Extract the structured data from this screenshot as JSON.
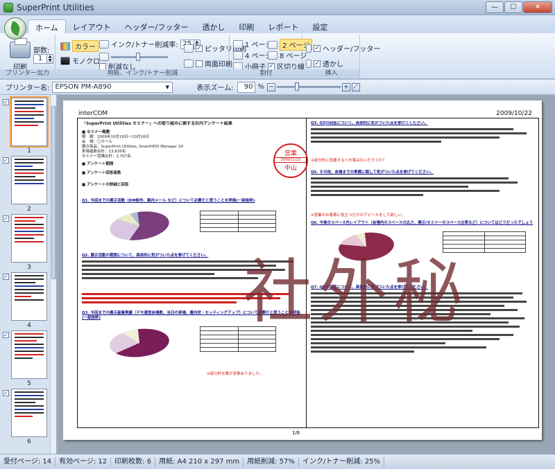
{
  "window": {
    "title": "SuperPrint Utilities"
  },
  "ribbon": {
    "tabs": [
      "ホーム",
      "レイアウト",
      "ヘッダー/フッター",
      "透かし",
      "印刷",
      "レポート",
      "設定"
    ],
    "print_output": {
      "label": "プリンター出力",
      "print_button": "印刷",
      "copies_label": "部数:",
      "copies_value": "1"
    },
    "paper_ink": {
      "label": "用紙、インク/トナー削減",
      "color_button": "カラー",
      "mono_button": "モノクロ",
      "ink_reduction_label": "インク/トナー削減率:",
      "ink_reduction_value": "25",
      "no_reduction_label": "削減なし",
      "fit_print_label": "ピッタリ印刷",
      "duplex_label": "両面印刷"
    },
    "imposition": {
      "label": "割付",
      "one_page": "1 ページ",
      "two_page": "2 ページ",
      "four_page": "4 ページ",
      "eight_page": "8 ページ",
      "booklet": "小冊子",
      "divider_line": "区切り線"
    },
    "insert": {
      "label": "挿入",
      "header_footer": "ヘッダー/フッター",
      "watermark": "透かし"
    }
  },
  "toolbar": {
    "printer_label": "プリンター名:",
    "printer_value": "EPSON PM-A890",
    "zoom_label": "表示ズーム:",
    "zoom_value": "90",
    "zoom_unit": "%"
  },
  "thumbnails": [
    {
      "num": "1",
      "checked": "✓"
    },
    {
      "num": "2",
      "checked": "✓"
    },
    {
      "num": "3",
      "checked": "✓"
    },
    {
      "num": "4",
      "checked": "✓"
    },
    {
      "num": "5",
      "checked": "✓"
    },
    {
      "num": "6",
      "checked": "✓"
    }
  ],
  "preview": {
    "header_left": "interCOM",
    "header_right": "2009/10/22",
    "page_number": "1/6",
    "watermark_text": "社外秘",
    "stamp_top": "営業",
    "stamp_date": "2009/11/22",
    "stamp_name": "中山",
    "left_col": {
      "title": "「SuperPrint Utilities セミナー」への取り組みに関する社内アンケート結果",
      "section1": "■ セミナー概要",
      "line1": "期　間：2009年10月19日～10月16日",
      "line2": "会　場：〇ホール",
      "line3": "展示商品：SuperPrint Utilities, SmartHDD Manager 20",
      "line4": "来場者数合計：13,826名",
      "line5": "セミナー受講合計：2,707名",
      "section2": "■ アンケート期間",
      "section3": "■ アンケート回答者数",
      "section4": "■ アンケートの詳細と回答",
      "q1": "Q1. 今回までの展示活動（DM制作、案内メール など）について必要だと思うことを評価(一部抜粋)",
      "q2": "Q2. 展示活動の期間について、具体的に気がついた点を挙げてください。",
      "q3": "Q3. 今回までの展示産業実績（デモ運営会場数、当日の来場、案内状・セッティングアップ）について必要だと思うことを評価(一部抜粋)"
    },
    "right_col": {
      "q3b": "Q3. Q3の回答について、具体的に気がついた点を挙げてください。",
      "q5": "Q5. その他、会場までの準備に関して気がついた点を挙げてください。",
      "q6": "Q6. 今後のスペース内レイアウト（会場内のスペースの広さ、展示/セミナーのスペース比率など）についてはどうだったでしょう",
      "q7": "Q7. Q7の回答について、具体的に気がついた点を挙げてください。",
      "note1": "※部分的に改善するべき事はないだろうか？",
      "note2": "※営業のお客様に役立つだけのアピールをして欲しい。",
      "note3": "※部分的な案が多数ありました。"
    }
  },
  "status": {
    "received": "受付ページ: 14",
    "valid": "有効ページ: 12",
    "printed": "印刷枚数: 6",
    "paper": "用紙: A4 210 x 297 mm",
    "paper_saving": "用紙削減: 57%",
    "ink_saving": "インク/トナー削減: 25%"
  }
}
